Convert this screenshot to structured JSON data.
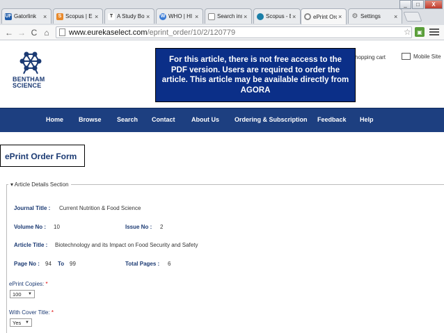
{
  "browser": {
    "tabs": [
      {
        "label": "Gatorlink",
        "icon": "UF",
        "color": "#1f5ca9"
      },
      {
        "label": "Scopus | E",
        "icon": "S",
        "color": "#e8892b"
      },
      {
        "label": "A Study Bo",
        "icon": "T",
        "color": "#333333"
      },
      {
        "label": "WHO | HI",
        "icon": "W",
        "color": "#3a7bd5"
      },
      {
        "label": "Search ins",
        "icon": "",
        "color": "#ffffff"
      },
      {
        "label": "Scopus - E",
        "icon": "",
        "color": "#1b7fa8"
      },
      {
        "label": "ePrint Ord",
        "icon": "",
        "color": "#888888",
        "active": true
      },
      {
        "label": "Settings",
        "icon": "",
        "color": "#777777"
      }
    ],
    "tab_close": "×",
    "url_domain": "www.eurekaselect.com",
    "url_path": "/eprint_order/10/2/120779",
    "win": {
      "min": "_",
      "max": "□",
      "close": "X"
    }
  },
  "header": {
    "logo_line1": "BENTHAM",
    "logo_line2": "SCIENCE",
    "cart": "hopping cart",
    "mobile": "Mobile Site"
  },
  "callout": "For this article, there is not free access to the PDF version. Users are required to order the article. This article may be available directly from AGORA",
  "nav": [
    "Home",
    "Browse",
    "Search",
    "Contact",
    "About Us",
    "Ordering & Subscription",
    "Feedback",
    "Help"
  ],
  "form": {
    "title": "ePrint Order Form",
    "section": "▾ Article Details Section",
    "journal_label": "Journal Title :",
    "journal_value": "Current Nutrition & Food Science",
    "volume_label": "Volume No :",
    "volume_value": "10",
    "issue_label": "Issue No :",
    "issue_value": "2",
    "article_label": "Article Title :",
    "article_value": "Biotechnology and its Impact on Food Security and Safety",
    "page_label": "Page No :",
    "page_from": "94",
    "to_label": "To",
    "page_to": "99",
    "total_label": "Total Pages :",
    "total_value": "6",
    "copies_label": "ePrint Copies:",
    "copies_value": "100",
    "cover_label": "With Cover Title:",
    "cover_value": "Yes",
    "required_mark": "*"
  }
}
